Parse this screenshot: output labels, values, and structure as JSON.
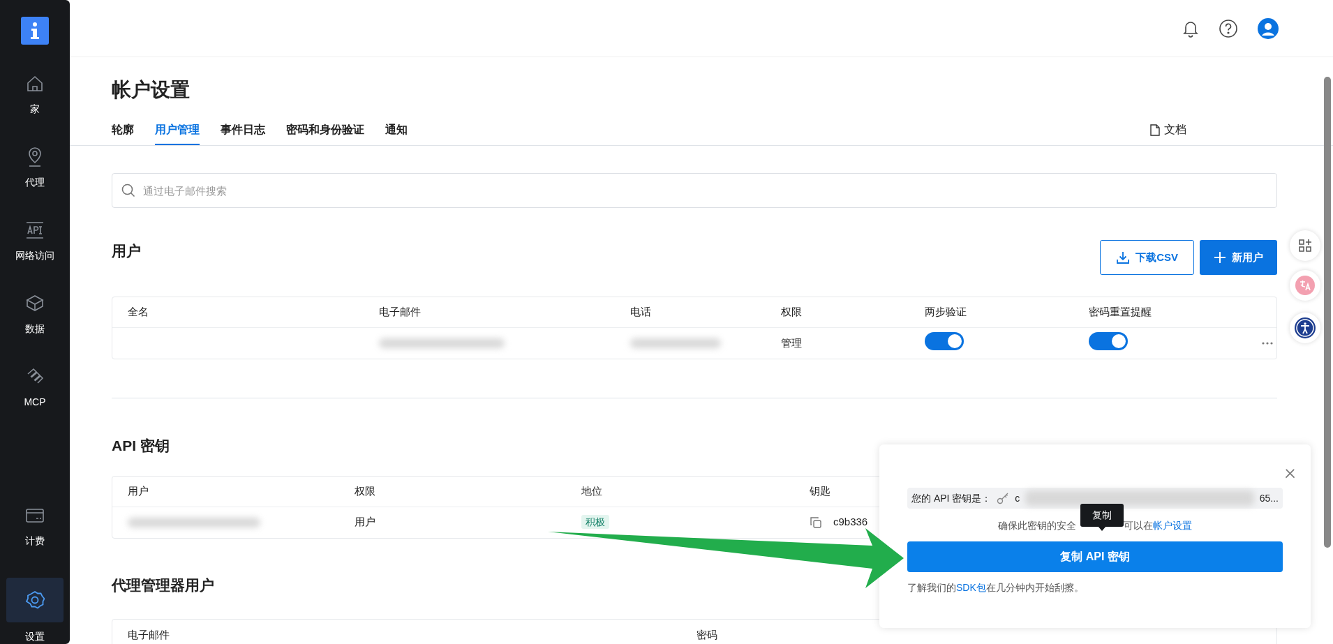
{
  "sidebar": {
    "items": [
      {
        "label": "家",
        "selected": false
      },
      {
        "label": "代理",
        "selected": false
      },
      {
        "label": "网络访问",
        "selected": false
      },
      {
        "label": "数据",
        "selected": false
      },
      {
        "label": "MCP",
        "selected": false
      },
      {
        "label": "计费",
        "selected": false
      },
      {
        "label": "设置",
        "selected": true
      }
    ]
  },
  "page": {
    "title": "帐户设置"
  },
  "tabs": [
    {
      "label": "轮廓",
      "selected": false
    },
    {
      "label": "用户管理",
      "selected": true
    },
    {
      "label": "事件日志",
      "selected": false
    },
    {
      "label": "密码和身份验证",
      "selected": false
    },
    {
      "label": "通知",
      "selected": false
    }
  ],
  "docs_link": "文档",
  "search": {
    "placeholder": "通过电子邮件搜索"
  },
  "users": {
    "title": "用户",
    "download_button": "下载CSV",
    "new_button": "新用户",
    "columns": [
      "全名",
      "电子邮件",
      "电话",
      "权限",
      "两步验证",
      "密码重置提醒"
    ],
    "rows": [
      {
        "permission": "管理",
        "two_step": {
          "on": true
        },
        "reset_reminder": {
          "on": true
        }
      }
    ]
  },
  "api_keys": {
    "title": "API 密钥",
    "columns": [
      "用户",
      "权限",
      "地位",
      "钥匙"
    ],
    "rows": [
      {
        "permission": "用户",
        "status": "积极",
        "key": "c9b336"
      }
    ]
  },
  "proxy_users": {
    "title": "代理管理器用户",
    "columns": [
      "电子邮件",
      "密码"
    ]
  },
  "popup": {
    "key_label": "您的 API 密钥是：",
    "key_start": "c",
    "key_end": "65...",
    "note_before": "确保此密钥的安全",
    "note_after": "可以在",
    "note_link": "帐户设置",
    "button": "复制 API 密钥",
    "tooltip": "复制",
    "footer_before": "了解我们的",
    "footer_link": "SDK包",
    "footer_after": "在几分钟内开始刮擦。"
  }
}
